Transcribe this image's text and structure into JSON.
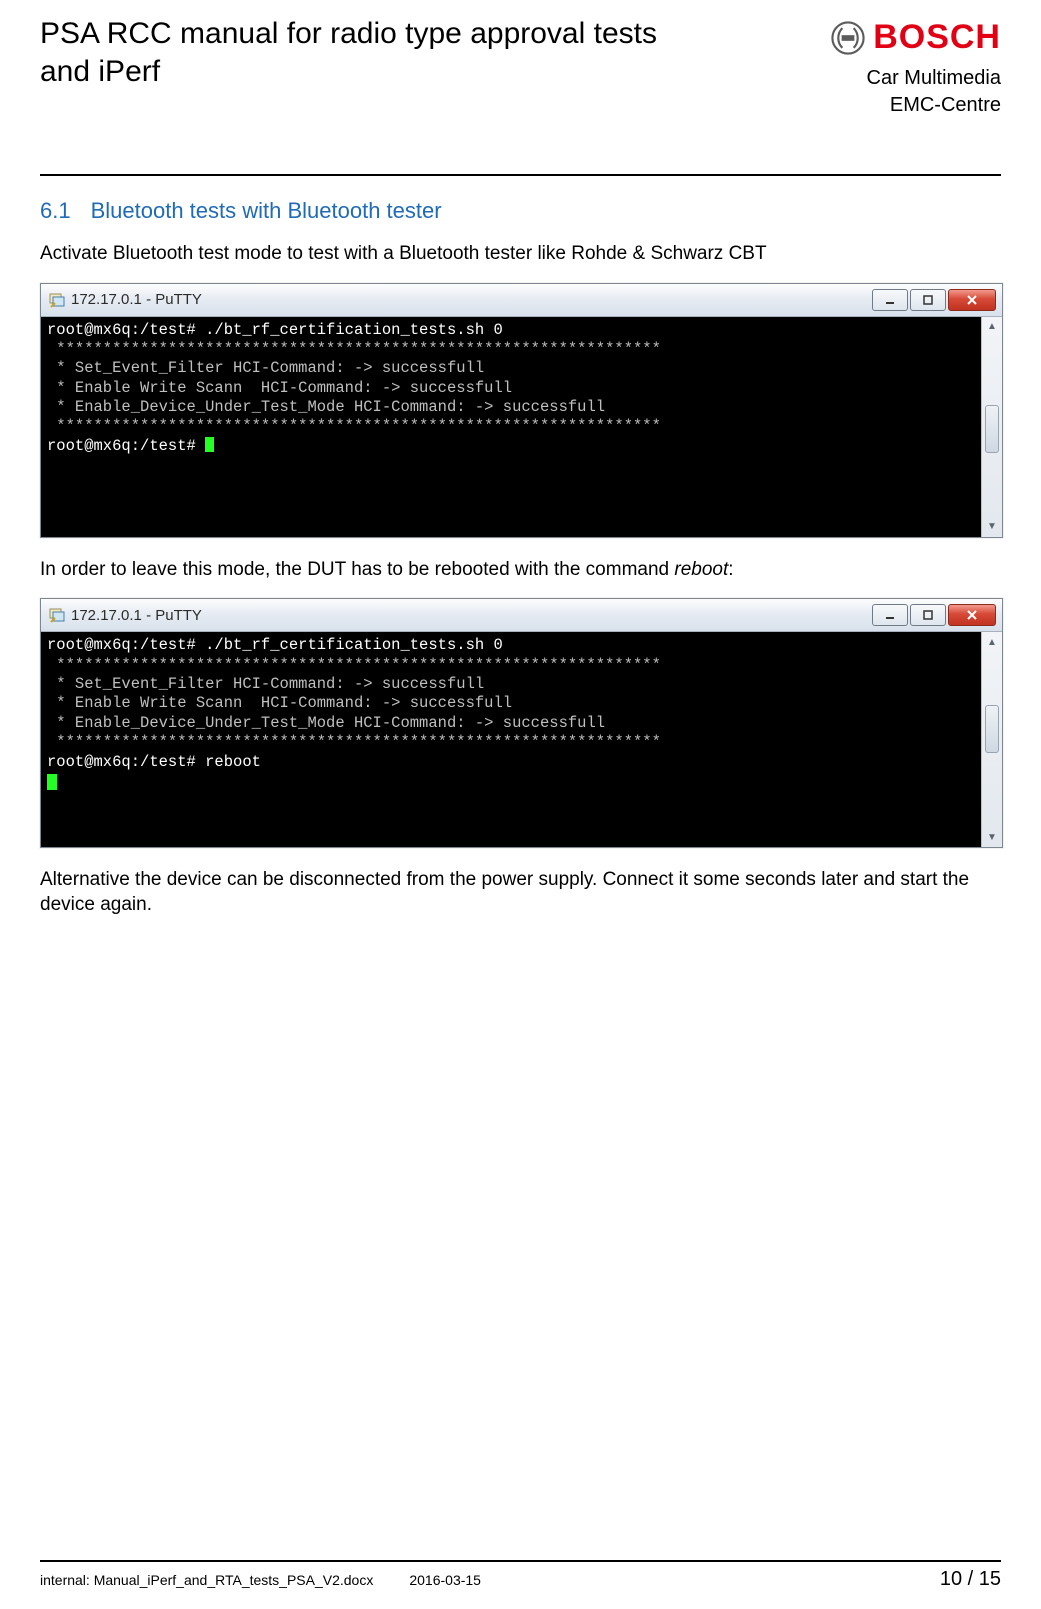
{
  "header": {
    "title": "PSA RCC manual for radio type approval tests and iPerf",
    "brand_line1": "Car Multimedia",
    "brand_line2": "EMC-Centre",
    "logo_word": "BOSCH"
  },
  "section": {
    "number": "6.1",
    "title": "Bluetooth tests with Bluetooth tester"
  },
  "para1": "Activate Bluetooth test mode to test with a Bluetooth tester like Rohde & Schwarz CBT",
  "para2_a": "In order to leave this mode, the DUT has to be rebooted with the command ",
  "para2_b": "reboot",
  "para2_c": ":",
  "para3": "Alternative the device can be disconnected from the power supply. Connect it some seconds later and start the device again.",
  "putty1": {
    "title": "172.17.0.1 - PuTTY",
    "lines": [
      "root@mx6q:/test# ./bt_rf_certification_tests.sh 0",
      " *****************************************************************",
      " * Set_Event_Filter HCI-Command: -> successfull",
      " * Enable Write Scann  HCI-Command: -> successfull",
      " * Enable_Device_Under_Test_Mode HCI-Command: -> successfull",
      " *****************************************************************",
      "root@mx6q:/test# "
    ]
  },
  "putty2": {
    "title": "172.17.0.1 - PuTTY",
    "lines": [
      "root@mx6q:/test# ./bt_rf_certification_tests.sh 0",
      " *****************************************************************",
      " * Set_Event_Filter HCI-Command: -> successfull",
      " * Enable Write Scann  HCI-Command: -> successfull",
      " * Enable_Device_Under_Test_Mode HCI-Command: -> successfull",
      " *****************************************************************",
      "root@mx6q:/test# reboot"
    ]
  },
  "window_btn_labels": {
    "min": "—",
    "max": "□",
    "close": "X"
  },
  "footer": {
    "left": "internal: Manual_iPerf_and_RTA_tests_PSA_V2.docx",
    "date": "2016-03-15",
    "page": "10 / 15"
  }
}
